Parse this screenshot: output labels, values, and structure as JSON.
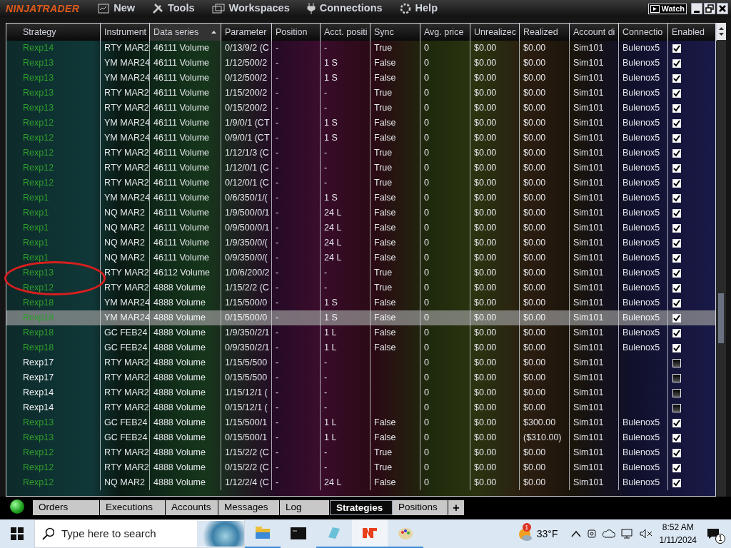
{
  "app": {
    "logo": "NINJATRADER",
    "menu": [
      "New",
      "Tools",
      "Workspaces",
      "Connections",
      "Help"
    ],
    "watch_button": "Watch"
  },
  "table": {
    "columns": [
      {
        "label": "Strategy",
        "sorted": false
      },
      {
        "label": "Instrument",
        "sorted": false
      },
      {
        "label": "Data series",
        "sorted": true
      },
      {
        "label": "Parameter",
        "sorted": false
      },
      {
        "label": "Position",
        "sorted": false
      },
      {
        "label": "Acct. positi",
        "sorted": false
      },
      {
        "label": "Sync",
        "sorted": false
      },
      {
        "label": "Avg. price",
        "sorted": false
      },
      {
        "label": "Unrealizec",
        "sorted": false
      },
      {
        "label": "Realized",
        "sorted": false
      },
      {
        "label": "Account di",
        "sorted": false
      },
      {
        "label": "Connectio",
        "sorted": false
      },
      {
        "label": "Enabled",
        "sorted": false
      }
    ],
    "rows": [
      {
        "cells": [
          "Rexp14",
          "RTY MAR2",
          "46111 Volume",
          "0/13/9/2 (C",
          "-",
          "-",
          "True",
          "0",
          "$0.00",
          "$0.00",
          "Sim101",
          "Bulenox5"
        ],
        "enabled": true,
        "selected": false
      },
      {
        "cells": [
          "Rexp13",
          "YM MAR24",
          "46111 Volume",
          "1/12/500/2",
          "-",
          "1 S",
          "False",
          "0",
          "$0.00",
          "$0.00",
          "Sim101",
          "Bulenox5"
        ],
        "enabled": true,
        "selected": false
      },
      {
        "cells": [
          "Rexp13",
          "YM MAR24",
          "46111 Volume",
          "0/12/500/2",
          "-",
          "1 S",
          "False",
          "0",
          "$0.00",
          "$0.00",
          "Sim101",
          "Bulenox5"
        ],
        "enabled": true,
        "selected": false
      },
      {
        "cells": [
          "Rexp13",
          "RTY MAR2",
          "46111 Volume",
          "1/15/200/2",
          "-",
          "-",
          "True",
          "0",
          "$0.00",
          "$0.00",
          "Sim101",
          "Bulenox5"
        ],
        "enabled": true,
        "selected": false
      },
      {
        "cells": [
          "Rexp13",
          "RTY MAR2",
          "46111 Volume",
          "0/15/200/2",
          "-",
          "-",
          "True",
          "0",
          "$0.00",
          "$0.00",
          "Sim101",
          "Bulenox5"
        ],
        "enabled": true,
        "selected": false
      },
      {
        "cells": [
          "Rexp12",
          "YM MAR24",
          "46111 Volume",
          "1/9/0/1 (CT",
          "-",
          "1 S",
          "False",
          "0",
          "$0.00",
          "$0.00",
          "Sim101",
          "Bulenox5"
        ],
        "enabled": true,
        "selected": false
      },
      {
        "cells": [
          "Rexp12",
          "YM MAR24",
          "46111 Volume",
          "0/9/0/1 (CT",
          "-",
          "1 S",
          "False",
          "0",
          "$0.00",
          "$0.00",
          "Sim101",
          "Bulenox5"
        ],
        "enabled": true,
        "selected": false
      },
      {
        "cells": [
          "Rexp12",
          "RTY MAR2",
          "46111 Volume",
          "1/12/1/3 (C",
          "-",
          "-",
          "True",
          "0",
          "$0.00",
          "$0.00",
          "Sim101",
          "Bulenox5"
        ],
        "enabled": true,
        "selected": false
      },
      {
        "cells": [
          "Rexp12",
          "RTY MAR2",
          "46111 Volume",
          "1/12/0/1 (C",
          "-",
          "-",
          "True",
          "0",
          "$0.00",
          "$0.00",
          "Sim101",
          "Bulenox5"
        ],
        "enabled": true,
        "selected": false
      },
      {
        "cells": [
          "Rexp12",
          "RTY MAR2",
          "46111 Volume",
          "0/12/0/1 (C",
          "-",
          "-",
          "True",
          "0",
          "$0.00",
          "$0.00",
          "Sim101",
          "Bulenox5"
        ],
        "enabled": true,
        "selected": false
      },
      {
        "cells": [
          "Rexp1",
          "YM MAR24",
          "46111 Volume",
          "0/6/350/1/(",
          "-",
          "1 S",
          "False",
          "0",
          "$0.00",
          "$0.00",
          "Sim101",
          "Bulenox5"
        ],
        "enabled": true,
        "selected": false
      },
      {
        "cells": [
          "Rexp1",
          "NQ MAR2",
          "46111 Volume",
          "1/9/500/0/1",
          "-",
          "24 L",
          "False",
          "0",
          "$0.00",
          "$0.00",
          "Sim101",
          "Bulenox5"
        ],
        "enabled": true,
        "selected": false
      },
      {
        "cells": [
          "Rexp1",
          "NQ MAR2",
          "46111 Volume",
          "0/9/500/0/1",
          "-",
          "24 L",
          "False",
          "0",
          "$0.00",
          "$0.00",
          "Sim101",
          "Bulenox5"
        ],
        "enabled": true,
        "selected": false
      },
      {
        "cells": [
          "Rexp1",
          "NQ MAR2",
          "46111 Volume",
          "1/9/350/0/(",
          "-",
          "24 L",
          "False",
          "0",
          "$0.00",
          "$0.00",
          "Sim101",
          "Bulenox5"
        ],
        "enabled": true,
        "selected": false
      },
      {
        "cells": [
          "Rexp1",
          "NQ MAR2",
          "46111 Volume",
          "0/9/350/0/(",
          "-",
          "24 L",
          "False",
          "0",
          "$0.00",
          "$0.00",
          "Sim101",
          "Bulenox5"
        ],
        "enabled": true,
        "selected": false
      },
      {
        "cells": [
          "Rexp13",
          "RTY MAR2",
          "46112 Volume",
          "1/0/6/200/2",
          "-",
          "-",
          "True",
          "0",
          "$0.00",
          "$0.00",
          "Sim101",
          "Bulenox5"
        ],
        "enabled": true,
        "selected": false
      },
      {
        "cells": [
          "Rexp12",
          "RTY MAR2",
          "4888 Volume",
          "1/15/2/2 (C",
          "-",
          "-",
          "True",
          "0",
          "$0.00",
          "$0.00",
          "Sim101",
          "Bulenox5"
        ],
        "enabled": true,
        "selected": false
      },
      {
        "cells": [
          "Rexp18",
          "YM MAR24",
          "4888 Volume",
          "1/15/500/0",
          "-",
          "1 S",
          "False",
          "0",
          "$0.00",
          "$0.00",
          "Sim101",
          "Bulenox5"
        ],
        "enabled": true,
        "selected": false
      },
      {
        "cells": [
          "Rexp18",
          "YM MAR24",
          "4888 Volume",
          "0/15/500/0",
          "-",
          "1 S",
          "False",
          "0",
          "$0.00",
          "$0.00",
          "Sim101",
          "Bulenox5"
        ],
        "enabled": true,
        "selected": true
      },
      {
        "cells": [
          "Rexp18",
          "GC FEB24",
          "4888 Volume",
          "1/9/350/2/1",
          "-",
          "1 L",
          "False",
          "0",
          "$0.00",
          "$0.00",
          "Sim101",
          "Bulenox5"
        ],
        "enabled": true,
        "selected": false
      },
      {
        "cells": [
          "Rexp18",
          "GC FEB24",
          "4888 Volume",
          "0/9/350/2/1",
          "-",
          "1 L",
          "False",
          "0",
          "$0.00",
          "$0.00",
          "Sim101",
          "Bulenox5"
        ],
        "enabled": true,
        "selected": false
      },
      {
        "cells": [
          "Rexp17",
          "RTY MAR2",
          "4888 Volume",
          "1/15/5/500",
          "-",
          "-",
          null,
          "0",
          "$0.00",
          "$0.00",
          "Sim101",
          null
        ],
        "enabled": false,
        "selected": false
      },
      {
        "cells": [
          "Rexp17",
          "RTY MAR2",
          "4888 Volume",
          "0/15/5/500",
          "-",
          "-",
          null,
          "0",
          "$0.00",
          "$0.00",
          "Sim101",
          null
        ],
        "enabled": false,
        "selected": false
      },
      {
        "cells": [
          "Rexp14",
          "RTY MAR2",
          "4888 Volume",
          "1/15/12/1 (",
          "-",
          "-",
          null,
          "0",
          "$0.00",
          "$0.00",
          "Sim101",
          null
        ],
        "enabled": false,
        "selected": false
      },
      {
        "cells": [
          "Rexp14",
          "RTY MAR2",
          "4888 Volume",
          "0/15/12/1 (",
          "-",
          "-",
          null,
          "0",
          "$0.00",
          "$0.00",
          "Sim101",
          null
        ],
        "enabled": false,
        "selected": false
      },
      {
        "cells": [
          "Rexp13",
          "GC FEB24",
          "4888 Volume",
          "1/15/500/1",
          "-",
          "1 L",
          "False",
          "0",
          "$0.00",
          "$300.00",
          "Sim101",
          "Bulenox5"
        ],
        "enabled": true,
        "selected": false
      },
      {
        "cells": [
          "Rexp13",
          "GC FEB24",
          "4888 Volume",
          "0/15/500/1",
          "-",
          "1 L",
          "False",
          "0",
          "$0.00",
          "($310.00)",
          "Sim101",
          "Bulenox5"
        ],
        "enabled": true,
        "selected": false
      },
      {
        "cells": [
          "Rexp12",
          "RTY MAR2",
          "4888 Volume",
          "1/15/2/2 (C",
          "-",
          "-",
          "True",
          "0",
          "$0.00",
          "$0.00",
          "Sim101",
          "Bulenox5"
        ],
        "enabled": true,
        "selected": false
      },
      {
        "cells": [
          "Rexp12",
          "RTY MAR2",
          "4888 Volume",
          "0/15/2/2 (C",
          "-",
          "-",
          "True",
          "0",
          "$0.00",
          "$0.00",
          "Sim101",
          "Bulenox5"
        ],
        "enabled": true,
        "selected": false
      },
      {
        "cells": [
          "Rexp12",
          "NQ MAR2",
          "4888 Volume",
          "1/12/2/4 (C",
          "-",
          "24 L",
          "False",
          "0",
          "$0.00",
          "$0.00",
          "Sim101",
          "Bulenox5"
        ],
        "enabled": true,
        "selected": false
      }
    ]
  },
  "bottom_tabs": [
    {
      "label": "Orders",
      "selected": false
    },
    {
      "label": "Executions",
      "selected": false
    },
    {
      "label": "Accounts",
      "selected": false
    },
    {
      "label": "Messages",
      "selected": false
    },
    {
      "label": "Log",
      "selected": false
    },
    {
      "label": "Strategies",
      "selected": true
    },
    {
      "label": "Positions",
      "selected": false
    }
  ],
  "add_tab": "+",
  "taskbar": {
    "search_placeholder": "Type here to search",
    "weather": {
      "badge": "1",
      "temperature": "33°F"
    },
    "time": "8:52 AM",
    "date": "1/11/2024",
    "notification_count": "1"
  }
}
